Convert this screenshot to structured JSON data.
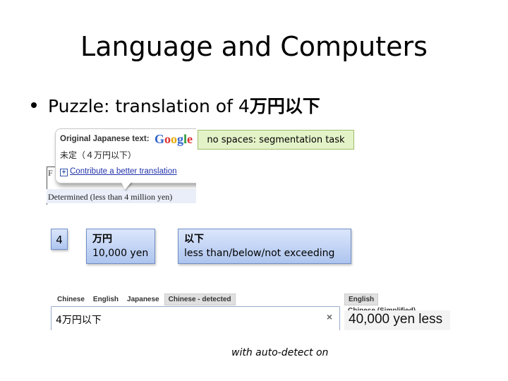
{
  "slide": {
    "title": "Language and Computers",
    "bullet": {
      "prefix": "Puzzle: translation of 4",
      "japanese": "万円以下"
    }
  },
  "google_popup": {
    "header": "Original Japanese text:",
    "logo_letters": [
      "G",
      "o",
      "o",
      "g",
      "l",
      "e"
    ],
    "original_text": "未定（４万円以下）",
    "contribute_link": "Contribute a better translation",
    "plus_icon": "+",
    "background_row_initial": "F",
    "translated_text": "Determined (less than 4 million yen)"
  },
  "callout": {
    "text": "no spaces: segmentation task"
  },
  "segments": [
    {
      "japanese": "4",
      "gloss": ""
    },
    {
      "japanese": "万円",
      "gloss": "10,000 yen"
    },
    {
      "japanese": "以下",
      "gloss": "less than/below/not exceeding"
    }
  ],
  "translate_input": {
    "tabs": [
      {
        "label": "Chinese",
        "selected": false
      },
      {
        "label": "English",
        "selected": false
      },
      {
        "label": "Japanese",
        "selected": false
      },
      {
        "label": "Chinese - detected",
        "selected": true
      }
    ],
    "value": "4万円以下",
    "clear_icon": "×"
  },
  "translate_output": {
    "tabs": [
      {
        "label": "English",
        "selected": true
      },
      {
        "label": "Chinese (Simplified)",
        "selected": false
      }
    ],
    "value": "40,000 yen less"
  },
  "caption": "with auto-detect on"
}
